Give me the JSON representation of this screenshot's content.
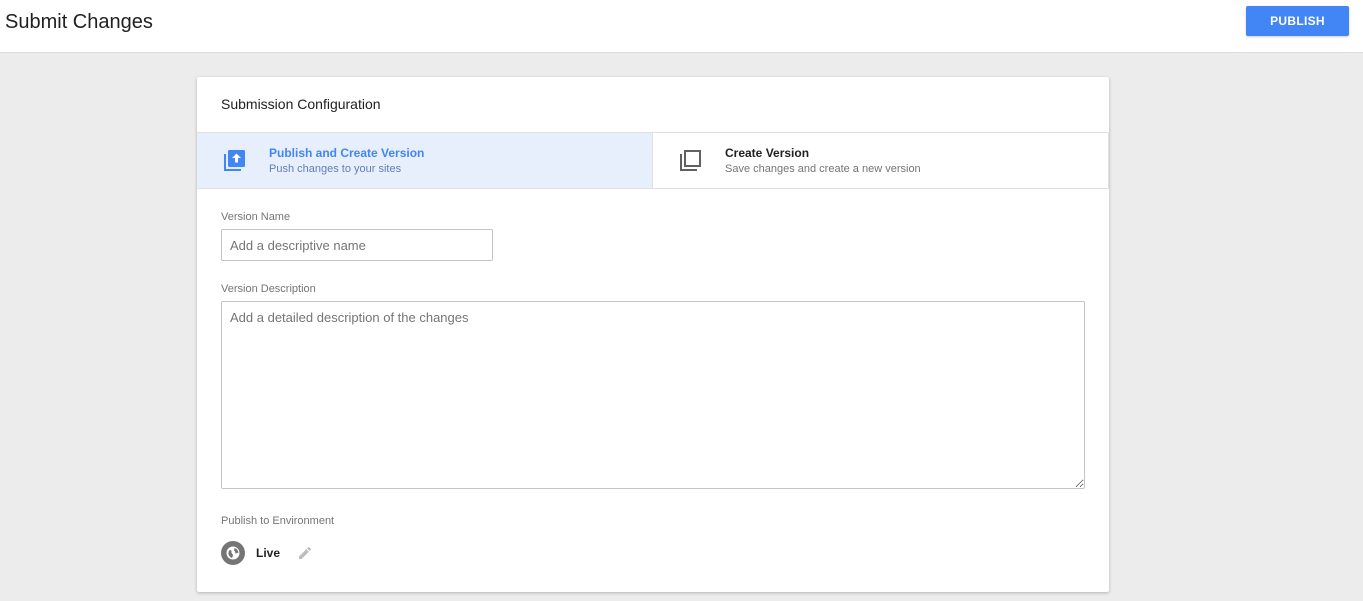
{
  "header": {
    "title": "Submit Changes",
    "publish_label": "PUBLISH"
  },
  "card": {
    "title": "Submission Configuration",
    "options": [
      {
        "title": "Publish and Create Version",
        "subtitle": "Push changes to your sites",
        "icon": "publish-icon",
        "selected": true
      },
      {
        "title": "Create Version",
        "subtitle": "Save changes and create a new version",
        "icon": "copy-version-icon",
        "selected": false
      }
    ],
    "version_name": {
      "label": "Version Name",
      "value": "",
      "placeholder": "Add a descriptive name"
    },
    "version_description": {
      "label": "Version Description",
      "value": "",
      "placeholder": "Add a detailed description of the changes"
    },
    "environment": {
      "label": "Publish to Environment",
      "name": "Live",
      "icon": "globe-icon",
      "edit_icon": "pencil-icon"
    }
  },
  "colors": {
    "accent": "#4285f4",
    "selected_bg": "#e8effc",
    "page_bg": "#ececec"
  }
}
